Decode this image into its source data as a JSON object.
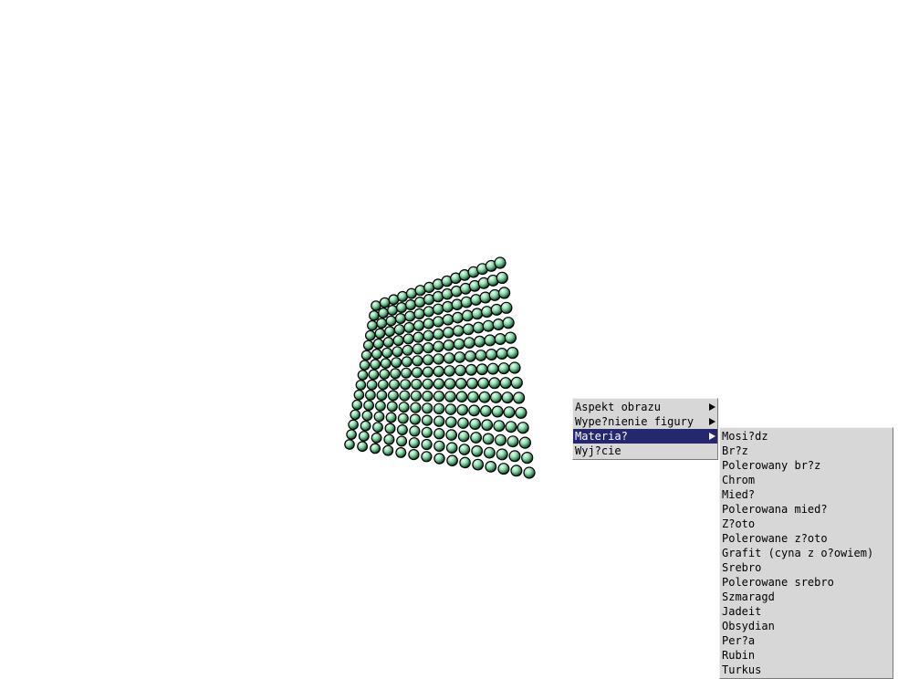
{
  "scene": {
    "object": "sphere-lattice-cube",
    "material_color": "#8fe0b0",
    "shadow_color": "#000000",
    "background": "#ffffff"
  },
  "context_menu": {
    "items": [
      {
        "label": "Aspekt obrazu",
        "submenu": true,
        "selected": false
      },
      {
        "label": "Wype?nienie figury",
        "submenu": true,
        "selected": false
      },
      {
        "label": "Materia?",
        "submenu": true,
        "selected": true
      },
      {
        "label": "Wyj?cie",
        "submenu": false,
        "selected": false
      }
    ],
    "highlight_color": "#26286f"
  },
  "material_submenu": {
    "items": [
      "Mosi?dz",
      "Br?z",
      "Polerowany br?z",
      "Chrom",
      "Mied?",
      "Polerowana mied?",
      "Z?oto",
      "Polerowane z?oto",
      "Grafit (cyna z o?owiem)",
      "Srebro",
      "Polerowane srebro",
      "Szmaragd",
      "Jadeit",
      "Obsydian",
      "Per?a",
      "Rubin",
      "Turkus"
    ]
  }
}
